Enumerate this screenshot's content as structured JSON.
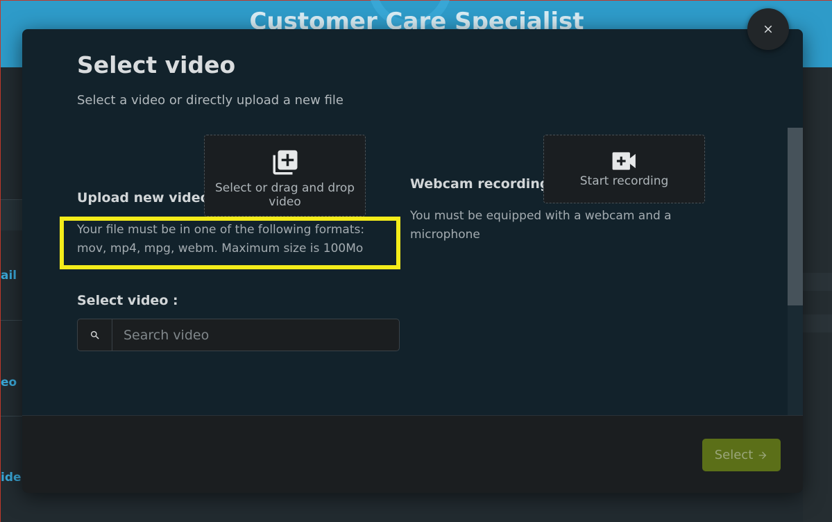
{
  "background": {
    "title": "Customer Care Specialist",
    "sidebar_fragments": [
      "ail",
      "eo",
      "ide"
    ]
  },
  "modal": {
    "title": "Select video",
    "subtitle": "Select a video or directly upload a new file",
    "upload": {
      "label": "Upload new video :",
      "dropzone_text": "Select or drag and drop video",
      "dropzone_icon": "library-add-icon",
      "helper_text": "Your file must be in one of the following formats: mov, mp4, mpg, webm. Maximum size is 100Mo"
    },
    "webcam": {
      "label": "Webcam recording :",
      "button_text": "Start recording",
      "button_icon": "videocam-icon",
      "helper_text": "You must be equipped with a webcam and a microphone"
    },
    "select_video": {
      "label": "Select video :",
      "search_placeholder": "Search video",
      "search_icon": "search-icon"
    },
    "footer": {
      "select_label": "Select",
      "select_icon": "arrow-right-icon"
    },
    "close_icon": "close-icon"
  },
  "colors": {
    "header_blue": "#2e9bc9",
    "modal_bg": "#12222b",
    "highlight": "#f4ec1a",
    "select_button": "#5b6f18"
  }
}
